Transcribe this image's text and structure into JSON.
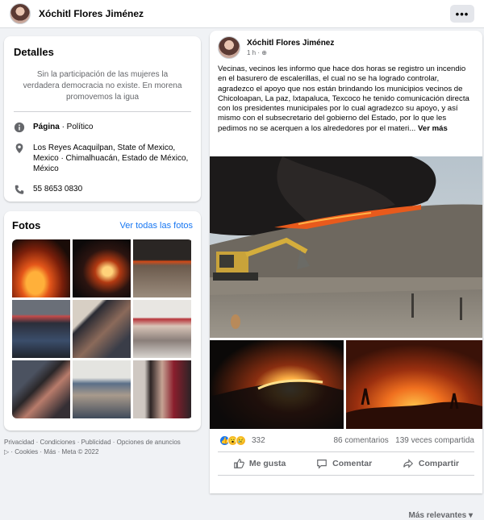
{
  "header": {
    "name": "Xóchitl Flores Jiménez",
    "more": "•••"
  },
  "details": {
    "title": "Detalles",
    "bio": "Sin la participación de las mujeres la verdadera democracia no existe. En morena promovemos la igua",
    "page_prefix": "Página",
    "page_category": " · Político",
    "address": "Los Reyes Acaquilpan, State of Mexico, Mexico · Chimalhuacán, Estado de México, México",
    "phone": "55 8653 0830"
  },
  "photos": {
    "title": "Fotos",
    "see_all": "Ver todas las fotos"
  },
  "footer": {
    "line1": "Privacidad · Condiciones · Publicidad · Opciones de anuncios",
    "line2": "▷ · Cookies · Más · Meta © 2022"
  },
  "post": {
    "author": "Xóchitl Flores Jiménez",
    "time": "1 h · ⊕",
    "text": "Vecinas, vecinos les informo  que hace dos horas se registro un incendio en el basurero de escalerillas,  el cual no se ha logrado controlar, agradezco el apoyo que nos están brindando los municipios vecinos de Chicoloapan,  La paz, Ixtapaluca, Texcoco he tenido comunicación directa con los presidentes municipales por lo cual agradezco su apoyo, y así  mismo con el subsecretario del gobierno del Estado, por lo que  les pedimos no se acerquen a los   alrededores por el materi...",
    "see_more": "Ver más",
    "reactions_count": "332",
    "comments": "86 comentarios",
    "shares": "139 veces compartida",
    "like": "Me gusta",
    "comment": "Comentar",
    "share": "Compartir",
    "sort": "Más relevantes ▾"
  }
}
